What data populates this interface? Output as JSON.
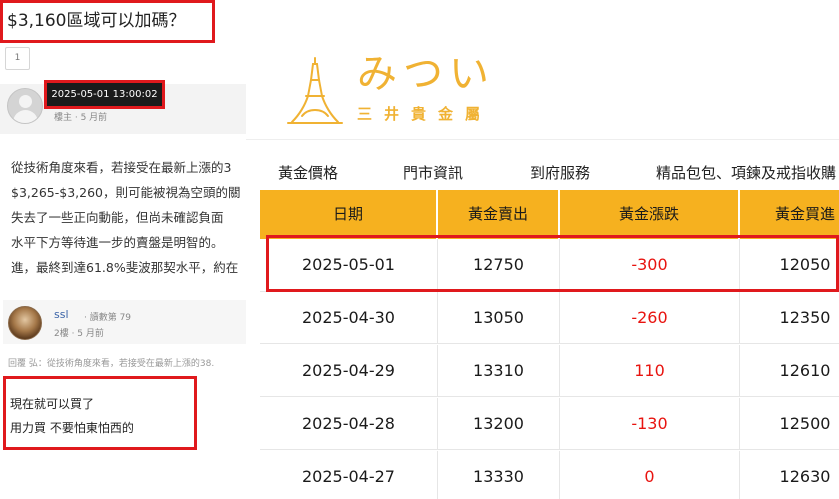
{
  "forum": {
    "title": "$3,160區域可以加碼？",
    "page_number": "1",
    "post": {
      "time": "2025-05-01 13:00:02",
      "meta": "樓主 · 5 月前",
      "lines": [
        "從技術角度來看，若接受在最新上漲的3",
        "$3,265-$3,260，則可能被視為空頭的關",
        "失去了一些正向動能，但尚未確認負面",
        "水平下方等待進一步的賣盤是明智的。",
        "進，最終到達61.8%斐波那契水平，約在"
      ]
    },
    "reply": {
      "user": "ssl",
      "views": "· 讀數第 79",
      "meta": "2樓 · 5 月前",
      "quote": "回覆 弘：從技術角度來看，若接受在最新上漲的38.",
      "lines": [
        "現在就可以買了",
        "用力買 不要怕東怕西的"
      ]
    }
  },
  "site": {
    "brand_jp": "みつい",
    "brand_cn": "三井貴金屬",
    "nav": [
      "黃金價格",
      "門市資訊",
      "到府服務",
      "精品包包、項鍊及戒指收購"
    ]
  },
  "table": {
    "headers": [
      "日期",
      "黃金賣出",
      "黃金漲跌",
      "黃金買進"
    ],
    "rows": [
      {
        "date": "2025-05-01",
        "sell": "12750",
        "change": "-300",
        "buy": "12050"
      },
      {
        "date": "2025-04-30",
        "sell": "13050",
        "change": "-260",
        "buy": "12350"
      },
      {
        "date": "2025-04-29",
        "sell": "13310",
        "change": "110",
        "buy": "12610"
      },
      {
        "date": "2025-04-28",
        "sell": "13200",
        "change": "-130",
        "buy": "12500"
      },
      {
        "date": "2025-04-27",
        "sell": "13330",
        "change": "0",
        "buy": "12630"
      }
    ]
  },
  "colors": {
    "accent_gold": "#f6b11f",
    "brand_gold": "#f0b233",
    "highlight_red": "#e0191d",
    "change_red": "#e8130f"
  }
}
